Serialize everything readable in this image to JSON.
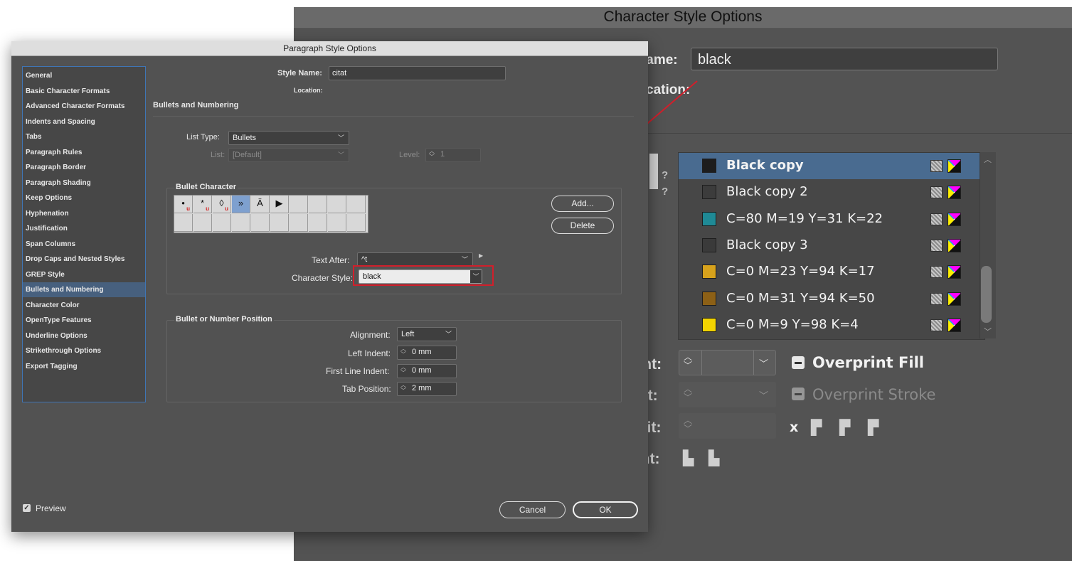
{
  "character_style": {
    "title": "Character Style Options",
    "name_label": "lame:",
    "name_value": "black",
    "location_label": "cation:",
    "swatches": [
      {
        "name": "Black copy",
        "color": "#1d1d1d",
        "selected": true
      },
      {
        "name": "Black copy 2",
        "color": "#3c3c3c",
        "selected": false
      },
      {
        "name": "C=80 M=19 Y=31 K=22",
        "color": "#1f8a96",
        "selected": false
      },
      {
        "name": "Black copy 3",
        "color": "#3a3a3a",
        "selected": false
      },
      {
        "name": "C=0 M=23 Y=94 K=17",
        "color": "#d7a21c",
        "selected": false
      },
      {
        "name": "C=0 M=31 Y=94 K=50",
        "color": "#8c6016",
        "selected": false
      },
      {
        "name": "C=0 M=9 Y=98 K=4",
        "color": "#f3d400",
        "selected": false
      }
    ],
    "tint_label": "Tint:",
    "weight_label": "ght:",
    "limit_label": "mit:",
    "align_label": "ent:",
    "overprint_fill": "Overprint Fill",
    "overprint_stroke": "Overprint Stroke",
    "x_label": "x"
  },
  "paragraph_style": {
    "title": "Paragraph Style Options",
    "sidebar": [
      "General",
      "Basic Character Formats",
      "Advanced Character Formats",
      "Indents and Spacing",
      "Tabs",
      "Paragraph Rules",
      "Paragraph Border",
      "Paragraph Shading",
      "Keep Options",
      "Hyphenation",
      "Justification",
      "Span Columns",
      "Drop Caps and Nested Styles",
      "GREP Style",
      "Bullets and Numbering",
      "Character Color",
      "OpenType Features",
      "Underline Options",
      "Strikethrough Options",
      "Export Tagging"
    ],
    "selected_index": 14,
    "style_name_label": "Style Name:",
    "style_name_value": "citat",
    "location_label": "Location:",
    "section_title": "Bullets and Numbering",
    "list_type_label": "List Type:",
    "list_type_value": "Bullets",
    "list_label": "List:",
    "list_value": "[Default]",
    "level_label": "Level:",
    "level_value": "1",
    "bullet_group": "Bullet Character",
    "bullets": [
      "•",
      "*",
      "◊",
      "»",
      "Ä",
      "▶"
    ],
    "add_button": "Add...",
    "delete_button": "Delete",
    "text_after_label": "Text After:",
    "text_after_value": "^t",
    "char_style_label": "Character Style:",
    "char_style_value": "black",
    "position_group": "Bullet or Number Position",
    "alignment_label": "Alignment:",
    "alignment_value": "Left",
    "left_indent_label": "Left Indent:",
    "left_indent_value": "0 mm",
    "first_line_label": "First Line Indent:",
    "first_line_value": "0 mm",
    "tab_position_label": "Tab Position:",
    "tab_position_value": "2 mm",
    "preview_label": "Preview",
    "cancel_button": "Cancel",
    "ok_button": "OK"
  },
  "colors": {
    "highlight": "#d11f2b",
    "selection": "#47607e",
    "accent_blue": "#3f75b5"
  }
}
